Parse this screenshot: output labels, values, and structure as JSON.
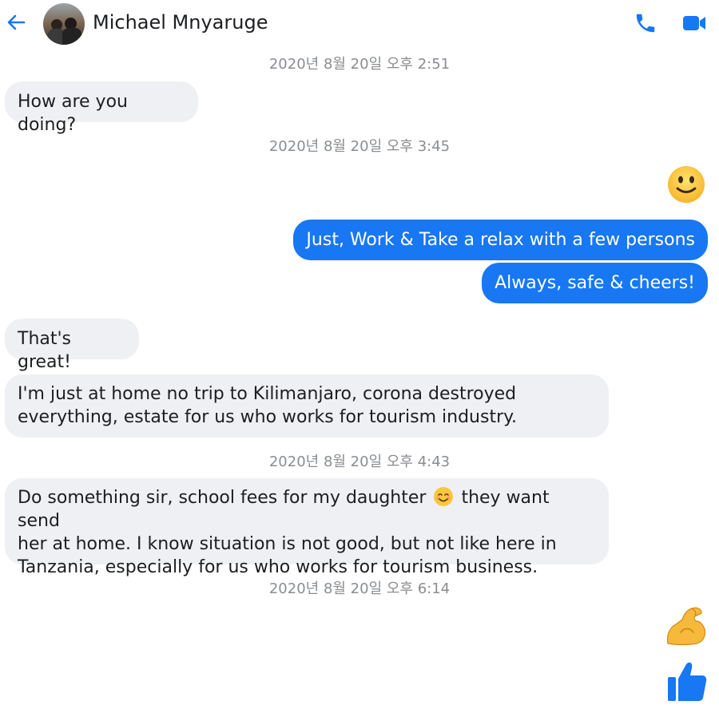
{
  "header": {
    "contact_name": "Michael Mnyaruge",
    "back_icon": "arrow-left-icon",
    "call_icon": "phone-icon",
    "video_icon": "video-camera-icon",
    "accent": "#1877f2"
  },
  "messages": {
    "ts1": "2020년 8월 20일 오후 2:51",
    "m1": "How are you doing?",
    "ts2": "2020년 8월 20일 오후 3:45",
    "sticker1": "slightly-smiling-face-emoji",
    "m2": "Just, Work & Take a relax with a few persons",
    "m3": "Always, safe & cheers!",
    "m4": "That's great!",
    "m5": "I'm just at home no trip to Kilimanjaro, corona destroyed\neverything, estate for us who works for tourism industry.",
    "ts3": "2020년 8월 20일 오후 4:43",
    "m6_a": "Do something sir, school fees  for my daughter ",
    "m6_emoji": "smiling-face-with-smiling-eyes-emoji",
    "m6_b": " they want send\nher at home. I know situation is not good, but not like here in\nTanzania, especially for us who works for tourism business.",
    "ts4": "2020년 8월 20일 오후 6:14",
    "sticker2": "flexed-biceps-emoji",
    "like_icon": "thumbs-up-icon"
  },
  "colors": {
    "incoming_bubble": "#eff0f3",
    "outgoing_bubble": "#1877f2",
    "timestamp": "#8a8d91"
  }
}
